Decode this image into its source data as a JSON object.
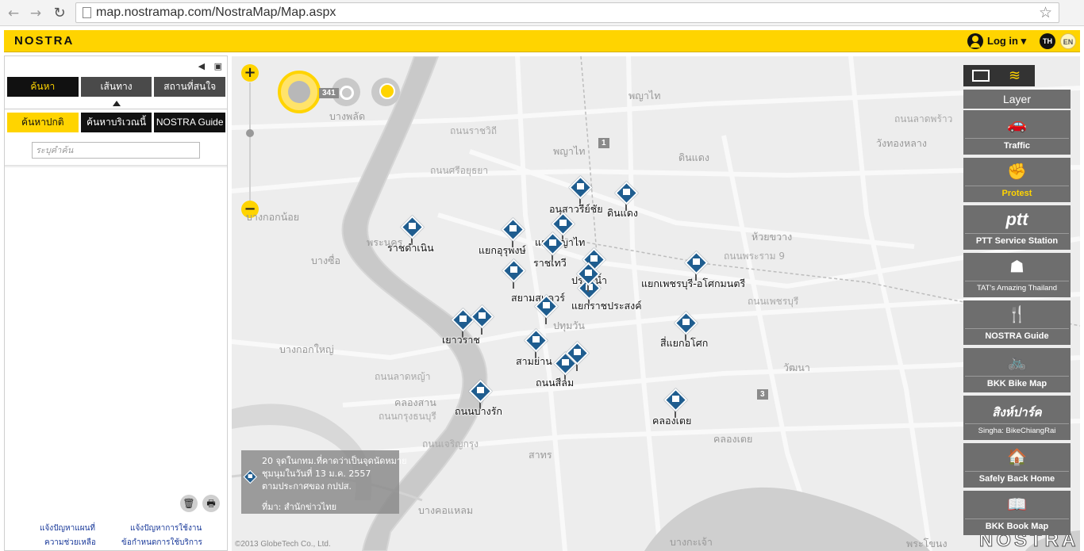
{
  "browser": {
    "url": "map.nostramap.com/NostraMap/Map.aspx"
  },
  "header": {
    "brand": "NOSTRA",
    "login_label": "Log in ▾",
    "lang_th": "TH",
    "lang_en": "EN"
  },
  "panel": {
    "tabs": [
      "ค้นหา",
      "เส้นทาง",
      "สถานที่สนใจ"
    ],
    "subtabs": [
      "ค้นหาปกติ",
      "ค้นหาบริเวณนี้",
      "NOSTRA Guide"
    ],
    "search_placeholder": "ระบุคำค้น",
    "links": [
      "แจ้งปัญหาแผนที่",
      "แจ้งปัญหาการใช้งาน",
      "ความช่วยเหลือ",
      "ข้อกำหนดการใช้บริการ"
    ]
  },
  "map": {
    "places": [
      {
        "id": "pt1",
        "text": "พญาไท",
        "road": false
      },
      {
        "id": "pt2",
        "text": "พญาไท",
        "road": false
      },
      {
        "id": "pt3",
        "text": "บางพลัด",
        "road": false
      },
      {
        "id": "pt4",
        "text": "ถนนราชวิถี",
        "road": true
      },
      {
        "id": "pt5",
        "text": "ถนนศรีอยุธยา",
        "road": true
      },
      {
        "id": "pt6",
        "text": "บางกอกน้อย",
        "road": false
      },
      {
        "id": "pt7",
        "text": "ดินแดง",
        "road": false
      },
      {
        "id": "pt8",
        "text": "ห้วยขวาง",
        "road": false
      },
      {
        "id": "pt9",
        "text": "ถนนพระราม 9",
        "road": true
      },
      {
        "id": "pt10",
        "text": "วังทองหลาง",
        "road": false
      },
      {
        "id": "pt11",
        "text": "ถนนลาดพร้าว",
        "road": true
      },
      {
        "id": "pt12",
        "text": "ปทุมวัน",
        "road": false
      },
      {
        "id": "pt13",
        "text": "บางกอกใหญ่",
        "road": false
      },
      {
        "id": "pt14",
        "text": "วัฒนา",
        "road": false
      },
      {
        "id": "pt15",
        "text": "คลองสาน",
        "road": false
      },
      {
        "id": "pt16",
        "text": "ถนนกรุงธนบุรี",
        "road": true
      },
      {
        "id": "pt17",
        "text": "สาทร",
        "road": false
      },
      {
        "id": "pt18",
        "text": "คลองเตย",
        "road": false
      },
      {
        "id": "pt19",
        "text": "บางคอแหลม",
        "road": false
      },
      {
        "id": "pt20",
        "text": "พระโขนง",
        "road": false
      },
      {
        "id": "pt21",
        "text": "บางกะเจ้า",
        "road": false
      },
      {
        "id": "pt22",
        "text": "ถนนลาดหญ้า",
        "road": true
      },
      {
        "id": "pt23",
        "text": "ถนนเพชรบุรี",
        "road": true
      },
      {
        "id": "pt24",
        "text": "ถนนเจริญกรุง",
        "road": true
      },
      {
        "id": "pt25",
        "text": "พระนคร",
        "road": false
      },
      {
        "id": "pt26",
        "text": "บางซื่อ",
        "road": false
      }
    ],
    "route_shields": [
      "341",
      "1",
      "3"
    ],
    "protests": [
      {
        "id": "p1",
        "label": "อนุสาวรีย์ชัย"
      },
      {
        "id": "p2",
        "label": "ดินแดง"
      },
      {
        "id": "p3",
        "label": "ราชดำเนิน"
      },
      {
        "id": "p4",
        "label": "แยกอุรุพงษ์"
      },
      {
        "id": "p5",
        "label": "แยกพญาไท"
      },
      {
        "id": "p6",
        "label": "ราชเทวี"
      },
      {
        "id": "p7",
        "label": "ประตูน้ำ"
      },
      {
        "id": "p8",
        "label": "แยกเพชรบุรี-อโศกมนตรี"
      },
      {
        "id": "p9",
        "label": "สยามสแควร์"
      },
      {
        "id": "p10",
        "label": "แยกราชประสงค์"
      },
      {
        "id": "p11",
        "label": "เยาวราช"
      },
      {
        "id": "p12",
        "label": "สี่แยกอโศก"
      },
      {
        "id": "p13",
        "label": "สามย่าน"
      },
      {
        "id": "p14",
        "label": "ถนนสีลม"
      },
      {
        "id": "p15",
        "label": "ถนนบางรัก"
      },
      {
        "id": "p16",
        "label": "คลองเตย"
      }
    ],
    "info_lines": [
      "20 จุดในกทม.ที่คาดว่าเป็นจุดนัดหมาย",
      "ชุมนุมในวันที่ 13 ม.ค. 2557",
      "ตามประกาศของ กปปส.",
      "ที่มา: สำนักข่าวไทย"
    ],
    "copyright": "©2013 GlobeTech Co., Ltd.",
    "watermark": "NOSTRA"
  },
  "layers": {
    "title": "Layer",
    "items": [
      {
        "label": "Traffic",
        "icon": "🚗",
        "icon_name": "traffic-icon"
      },
      {
        "label": "Protest",
        "icon": "✊",
        "icon_name": "protest-icon"
      },
      {
        "label": "PTT Service Station",
        "icon": "ptt",
        "icon_name": "ptt-icon"
      },
      {
        "label": "TAT's Amazing Thailand",
        "icon": "☗",
        "icon_name": "tat-icon"
      },
      {
        "label": "NOSTRA Guide",
        "icon": "🍴",
        "icon_name": "guide-icon"
      },
      {
        "label": "BKK Bike Map",
        "icon": "🚲",
        "icon_name": "bike-icon"
      },
      {
        "label": "Singha: BikeChiangRai",
        "icon": "สิงห์ปาร์ค",
        "icon_name": "singha-icon"
      },
      {
        "label": "Safely Back Home",
        "icon": "🏠",
        "icon_name": "home-icon"
      },
      {
        "label": "BKK Book Map",
        "icon": "📖",
        "icon_name": "book-icon"
      }
    ]
  },
  "colors": {
    "brand_yellow": "#ffd400",
    "marker_blue": "#1f5d8f",
    "river": "#c9c9c9"
  }
}
